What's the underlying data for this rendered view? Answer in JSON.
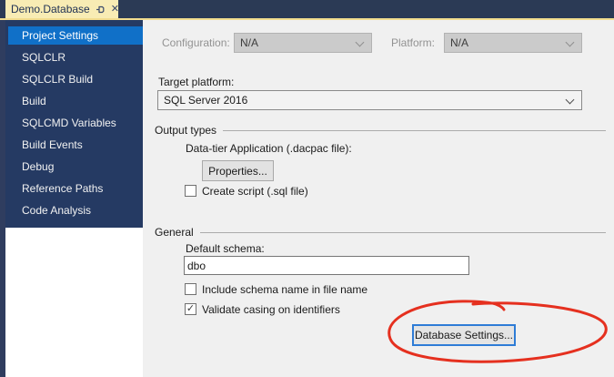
{
  "tab": {
    "title": "Demo.Database"
  },
  "icons": {
    "tab_pin": "pushpin-icon",
    "tab_close": "✕",
    "checkbox_check": "✓"
  },
  "sidebar": {
    "items": [
      {
        "label": "Project Settings",
        "selected": true
      },
      {
        "label": "SQLCLR",
        "selected": false
      },
      {
        "label": "SQLCLR Build",
        "selected": false
      },
      {
        "label": "Build",
        "selected": false
      },
      {
        "label": "SQLCMD Variables",
        "selected": false
      },
      {
        "label": "Build Events",
        "selected": false
      },
      {
        "label": "Debug",
        "selected": false
      },
      {
        "label": "Reference Paths",
        "selected": false
      },
      {
        "label": "Code Analysis",
        "selected": false
      }
    ]
  },
  "toolbar": {
    "configuration_label": "Configuration:",
    "configuration_value": "N/A",
    "platform_label": "Platform:",
    "platform_value": "N/A"
  },
  "target_platform": {
    "label": "Target platform:",
    "value": "SQL Server 2016"
  },
  "output_types": {
    "header": "Output types",
    "dacpac_label": "Data-tier Application (.dacpac file):",
    "properties_button": "Properties...",
    "create_script_label": "Create script (.sql file)",
    "create_script_checked": false
  },
  "general": {
    "header": "General",
    "default_schema_label": "Default schema:",
    "default_schema_value": "dbo",
    "include_schema_label": "Include schema name in file name",
    "include_schema_checked": false,
    "validate_casing_label": "Validate casing on identifiers",
    "validate_casing_checked": true,
    "database_settings_button": "Database Settings..."
  },
  "annotation": {
    "shape": "hand-drawn-ellipse",
    "color": "#e5301f"
  },
  "colors": {
    "tabstrip_bg": "#2b3a55",
    "tab_bg": "#f8ecb4",
    "gold_line": "#f2dd8f",
    "nav_panel_bg": "#253a63",
    "selected_item_bg": "#1070c8",
    "content_bg": "#f0f0f0",
    "focus_border": "#2e7cd6",
    "annotation_red": "#e5301f"
  }
}
